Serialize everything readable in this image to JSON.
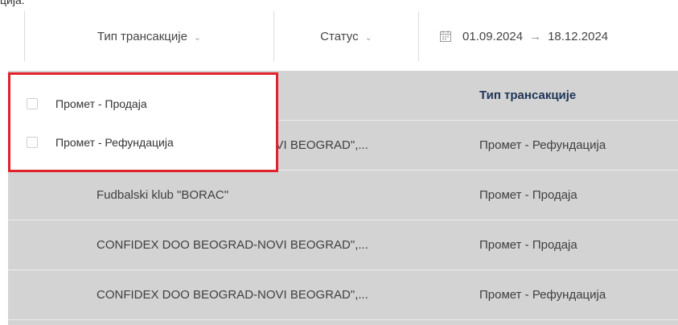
{
  "top_fragment": "ција.",
  "filters": {
    "transaction_type_label": "Тип трансакције",
    "status_label": "Статус",
    "date_from": "01.09.2024",
    "date_arrow": "→",
    "date_to": "18.12.2024"
  },
  "table": {
    "header": {
      "col2": "Тип трансакције"
    },
    "rows": [
      {
        "col1": "CONFIDEX DOO BEOGRAD-NOVI BEOGRAD\",...",
        "col2": "Промет - Рефундација"
      },
      {
        "col1": "Fudbalski klub \"BORAC\"",
        "col2": "Промет - Продаја"
      },
      {
        "col1": "CONFIDEX DOO BEOGRAD-NOVI BEOGRAD\",...",
        "col2": "Промет - Продаја"
      },
      {
        "col1": "CONFIDEX DOO BEOGRAD-NOVI BEOGRAD\",...",
        "col2": "Промет - Рефундација"
      }
    ]
  },
  "dropdown": {
    "options": [
      {
        "label": "Промет - Продаја",
        "checked": false
      },
      {
        "label": "Промет - Рефундација",
        "checked": false
      }
    ]
  },
  "colors": {
    "highlight_border": "#e1222c",
    "table_bg": "#d3d3d3",
    "header_text": "#1d3557"
  },
  "icons": {
    "calendar": "calendar-icon",
    "chevron": "chevron-down-icon",
    "arrow": "arrow-right-icon"
  }
}
